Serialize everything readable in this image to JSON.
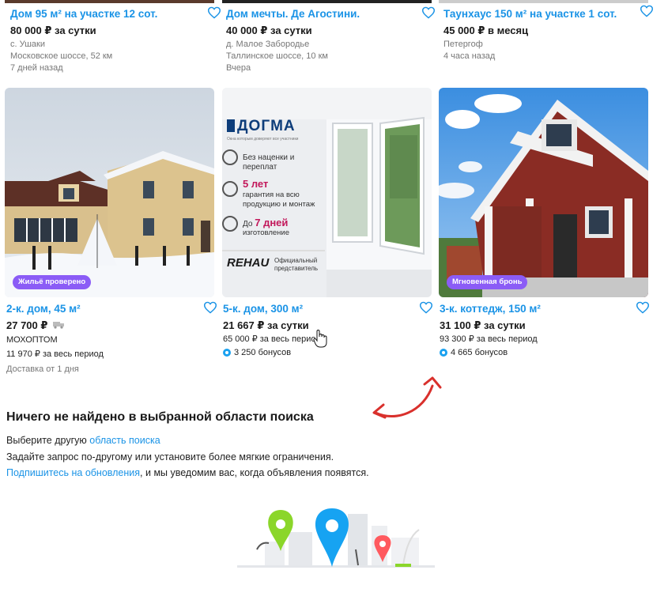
{
  "top_cards": [
    {
      "title": "Дом 95 м² на участке 12 сот.",
      "price": "80 000 ₽ за сутки",
      "lines": [
        "с. Ушаки",
        "Московское шоссе, 52 км",
        "7 дней назад"
      ]
    },
    {
      "title": "Дом мечты. Де Агостини.",
      "price": "40 000 ₽ за сутки",
      "lines": [
        "д. Малое Забородье",
        "Таллинское шоссе, 10 км",
        "Вчера"
      ]
    },
    {
      "title": "Таунхаус 150 м² на участке 1 сот.",
      "price": "45 000 ₽ в месяц",
      "lines": [
        "Петергоф",
        "4 часа назад"
      ]
    }
  ],
  "cards": [
    {
      "title": "2-к. дом, 45 м²",
      "price": "27 700 ₽",
      "seller": "МОХОПТОМ",
      "period": "11 970 ₽ за весь период",
      "delivery": "Доставка от 1 дня",
      "badge": "Жильё проверено"
    },
    {
      "title": "5-к. дом, 300 м²",
      "price": "21 667 ₽ за сутки",
      "period": "65 000 ₽ за весь период",
      "bonus": "3 250 бонусов",
      "ad": {
        "brand": "ДОГМА",
        "tagline": "Окна которым доверяют все участники",
        "f1": "Без наценки и переплат",
        "f2a": "5 лет",
        "f2b": "гарантия на всю продукцию и монтаж",
        "f3a": "До",
        "f3b": "7 дней",
        "f3c": "изготовление",
        "rehau": "REHAU",
        "rehau_note": "Официальный представитель"
      }
    },
    {
      "title": "3-к. коттедж, 150 м²",
      "price": "31 100 ₽ за сутки",
      "period": "93 300 ₽ за весь период",
      "bonus": "4 665 бонусов",
      "badge": "Мгновенная бронь"
    }
  ],
  "empty": {
    "title": "Ничего не найдено в выбранной области поиска",
    "line1_prefix": "Выберите другую",
    "line1_link": "область поиска",
    "line2": "Задайте запрос по-другому или установите более мягкие ограничения.",
    "line3_link": "Подпишитесь на обновления",
    "line3_suffix": ", и мы уведомим вас, когда объявления появятся."
  },
  "colors": {
    "link": "#1a93e6",
    "badge": "#8b5cf6",
    "bonus": "#1aa1f0",
    "arrow": "#d9302c"
  }
}
